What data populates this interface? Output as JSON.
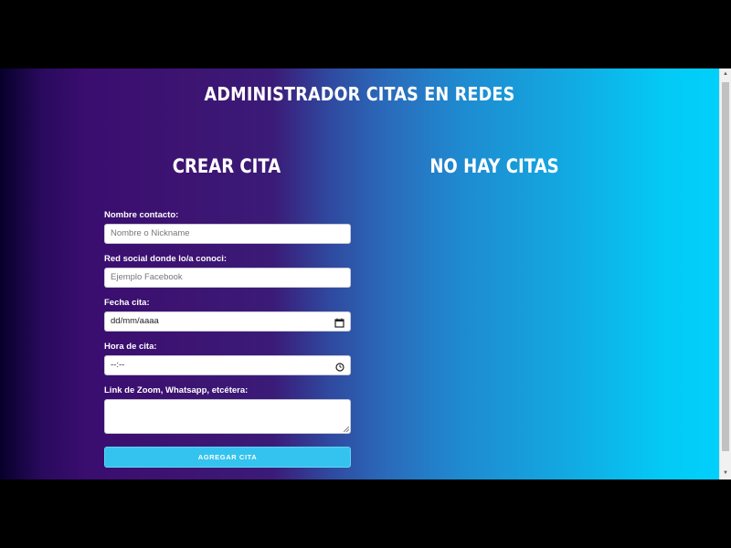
{
  "app": {
    "title": "Administrador citas en redes"
  },
  "left_section": {
    "title": "Crear cita"
  },
  "right_section": {
    "title": "No hay citas"
  },
  "form": {
    "nombre": {
      "label": "Nombre contacto:",
      "placeholder": "Nombre o Nickname"
    },
    "red": {
      "label": "Red social donde lo/a conoci:",
      "placeholder": "Ejemplo Facebook"
    },
    "fecha": {
      "label": "Fecha cita:",
      "value": "dd/mm/aaaa"
    },
    "hora": {
      "label": "Hora de cita:",
      "value": "--:--"
    },
    "link": {
      "label": "Link de Zoom, Whatsapp, etcétera:",
      "value": ""
    },
    "submit_label": "Agregar cita"
  },
  "icons": {
    "fecha": "calendar-icon",
    "hora": "clock-icon",
    "scroll_up": "arrow-up-icon",
    "scroll_down": "arrow-down-icon"
  },
  "colors": {
    "gradient_start": "#07002b",
    "gradient_mid": "#3d1472",
    "gradient_end": "#00d0fb",
    "button": "#34c3ee",
    "title_text": "#ffffff"
  }
}
